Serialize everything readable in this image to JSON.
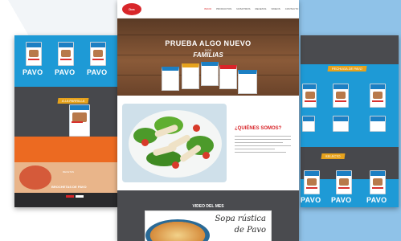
{
  "nav": {
    "logo": "Dos Familias",
    "menu": [
      "INICIO",
      "PRODUCTOS",
      "NOSOTROS",
      "RECETAS",
      "VIDEOS",
      "CONTACTO"
    ]
  },
  "hero": {
    "title": "PRUEBA ALGO NUEVO",
    "subtitle": "DOS",
    "brand": "FAMILIAS"
  },
  "about": {
    "title": "¿QUIÉNES SOMOS?"
  },
  "video": {
    "title": "VIDEO DEL MES",
    "script_line1": "Sopa rústica",
    "script_line2": "de Pavo"
  },
  "left": {
    "pavo": [
      "PAVO",
      "PAVO",
      "PAVO"
    ],
    "tag": "A LA PARRILLA",
    "recipe_label": "RECETAS",
    "recipe_title": "BROCHETAS DE PAVO"
  },
  "right": {
    "tag1": "PECHUGA DE PAVO",
    "tag2": "SELECTO",
    "pavo": [
      "PAVO",
      "PAVO",
      "PAVO"
    ]
  },
  "colors": {
    "brand_red": "#d8262a",
    "brand_blue": "#1e9ad6",
    "accent_orange": "#ec6a21",
    "dark_gray": "#47484c"
  }
}
